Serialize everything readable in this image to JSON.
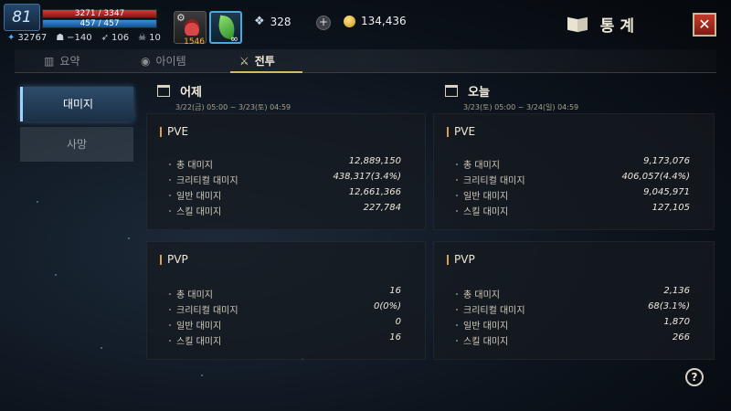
{
  "hud": {
    "level": "81",
    "hp": "3271 / 3347",
    "mp": "457 / 457",
    "combat_power": "32767",
    "stat_a": "−140",
    "stat_b": "106",
    "stat_c": "10",
    "potion_qty": "1546",
    "leaf_badge": "∞",
    "crystals": "328",
    "gold": "134,436"
  },
  "window": {
    "title": "통계",
    "close_label": "✕"
  },
  "tabs": [
    {
      "label": "요약",
      "icon": "bar-chart-icon"
    },
    {
      "label": "아이템",
      "icon": "item-icon"
    },
    {
      "label": "전투",
      "icon": "battle-icon"
    }
  ],
  "side_menu": [
    {
      "label": "대미지"
    },
    {
      "label": "사망"
    }
  ],
  "columns": {
    "yesterday": {
      "title": "어제",
      "range": "3/22(금) 05:00 ~ 3/23(토) 04:59",
      "pve": {
        "heading": "PVE",
        "rows": [
          {
            "label": "총 대미지",
            "value": "12,889,150"
          },
          {
            "label": "크리티컬 대미지",
            "value": "438,317(3.4%)"
          },
          {
            "label": "일반 대미지",
            "value": "12,661,366"
          },
          {
            "label": "스킬 대미지",
            "value": "227,784"
          }
        ]
      },
      "pvp": {
        "heading": "PVP",
        "rows": [
          {
            "label": "총 대미지",
            "value": "16"
          },
          {
            "label": "크리티컬 대미지",
            "value": "0(0%)"
          },
          {
            "label": "일반 대미지",
            "value": "0"
          },
          {
            "label": "스킬 대미지",
            "value": "16"
          }
        ]
      }
    },
    "today": {
      "title": "오늘",
      "range": "3/23(토) 05:00 ~ 3/24(일) 04:59",
      "pve": {
        "heading": "PVE",
        "rows": [
          {
            "label": "총 대미지",
            "value": "9,173,076"
          },
          {
            "label": "크리티컬 대미지",
            "value": "406,057(4.4%)"
          },
          {
            "label": "일반 대미지",
            "value": "9,045,971"
          },
          {
            "label": "스킬 대미지",
            "value": "127,105"
          }
        ]
      },
      "pvp": {
        "heading": "PVP",
        "rows": [
          {
            "label": "총 대미지",
            "value": "2,136"
          },
          {
            "label": "크리티컬 대미지",
            "value": "68(3.1%)"
          },
          {
            "label": "일반 대미지",
            "value": "1,870"
          },
          {
            "label": "스킬 대미지",
            "value": "266"
          }
        ]
      }
    }
  },
  "help_label": "?"
}
